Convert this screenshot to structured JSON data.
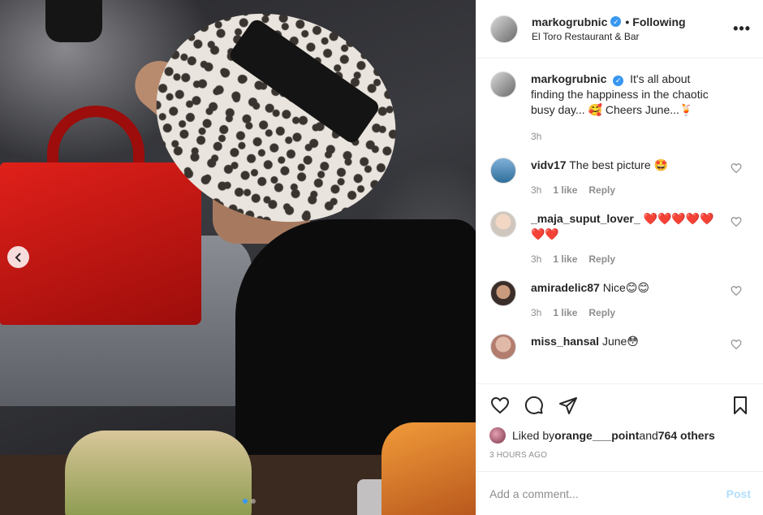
{
  "header": {
    "username": "markogrubnic",
    "separator": "•",
    "follow_label": "Following",
    "location": "El Toro Restaurant & Bar",
    "more_label": "•••"
  },
  "caption": {
    "username": "markogrubnic",
    "text": "It's all about finding the happiness in the chaotic busy day... 🥰 Cheers June...🍹",
    "time": "3h"
  },
  "comments": [
    {
      "username": "vidv17",
      "text": "The best picture 🤩",
      "time": "3h",
      "likes": "1 like",
      "reply": "Reply"
    },
    {
      "username": "_maja_suput_lover_",
      "text": "❤️❤️❤️❤️❤️❤️❤️",
      "time": "3h",
      "likes": "1 like",
      "reply": "Reply"
    },
    {
      "username": "amiradelic87",
      "text": "Nice😊😊",
      "time": "3h",
      "likes": "1 like",
      "reply": "Reply"
    },
    {
      "username": "miss_hansal",
      "text": "June😳"
    }
  ],
  "likes": {
    "prefix": "Liked by ",
    "user": "orange___point",
    "middle": " and ",
    "others": "764 others"
  },
  "timestamp": "3 hours ago",
  "add_comment": {
    "placeholder": "Add a comment...",
    "post_label": "Post"
  },
  "carousel": {
    "slide_count": 2,
    "active_index": 0
  },
  "colors": {
    "accent": "#3897f0",
    "post_disabled": "#b2dffc",
    "muted": "#8e8e8e"
  }
}
